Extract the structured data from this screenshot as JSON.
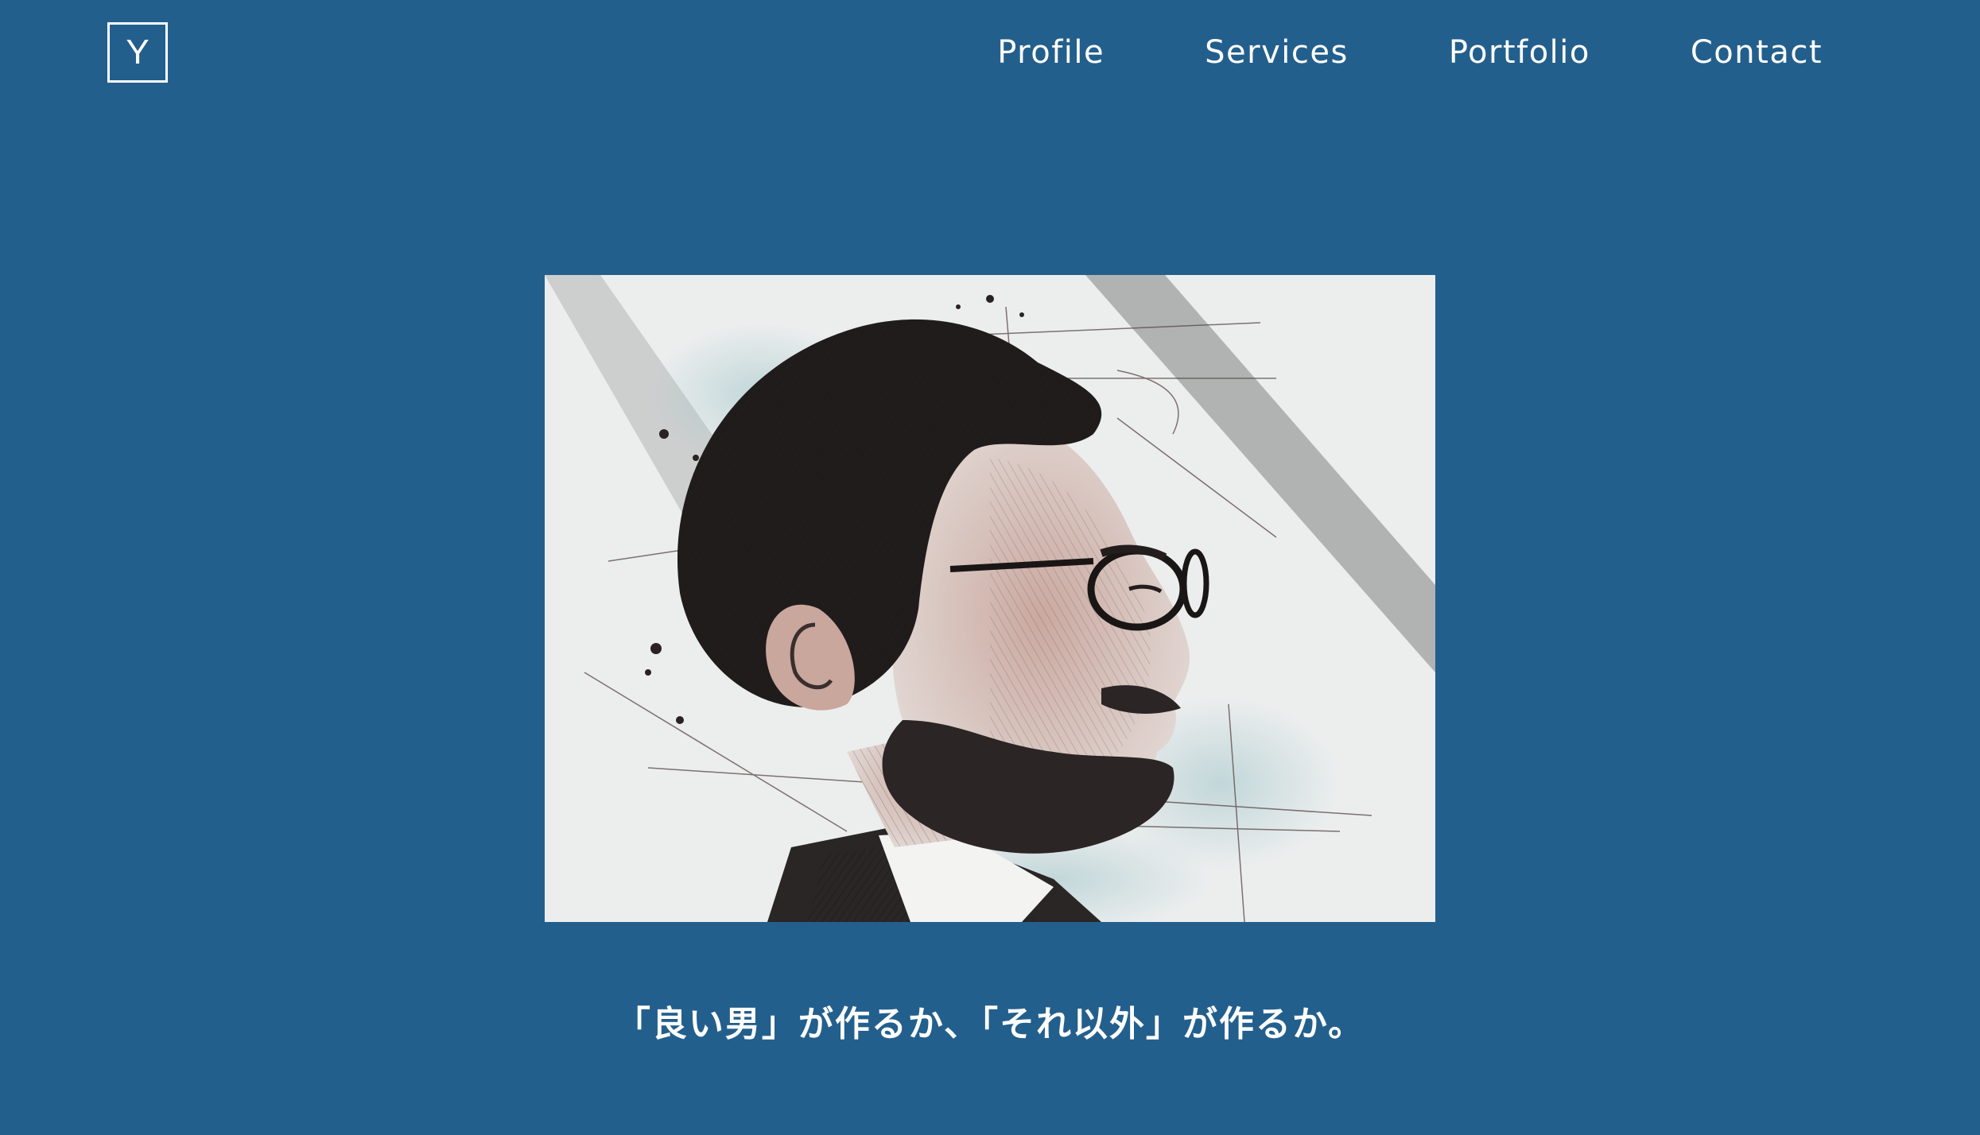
{
  "header": {
    "logo_text": "Y",
    "nav": {
      "profile": "Profile",
      "services": "Services",
      "portfolio": "Portfolio",
      "contact": "Contact"
    }
  },
  "hero": {
    "image_subject": "sketch-portrait-of-bearded-man-with-glasses-in-profile"
  },
  "tagline": "「良い男」が作るか、「それ以外」が作るか。",
  "colors": {
    "background": "#235f8c",
    "text": "#ffffff"
  }
}
